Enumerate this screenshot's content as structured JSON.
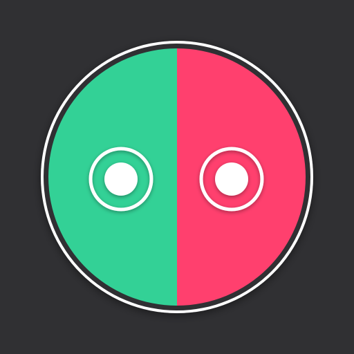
{
  "app_icon": {
    "background_color": "#303033",
    "ring_color": "#ffffff",
    "left_half_color": "#33d196",
    "right_half_color": "#ff406e",
    "eye_color": "#ffffff",
    "icon_names": [
      "app-icon",
      "left-eye-icon",
      "right-eye-icon"
    ]
  }
}
